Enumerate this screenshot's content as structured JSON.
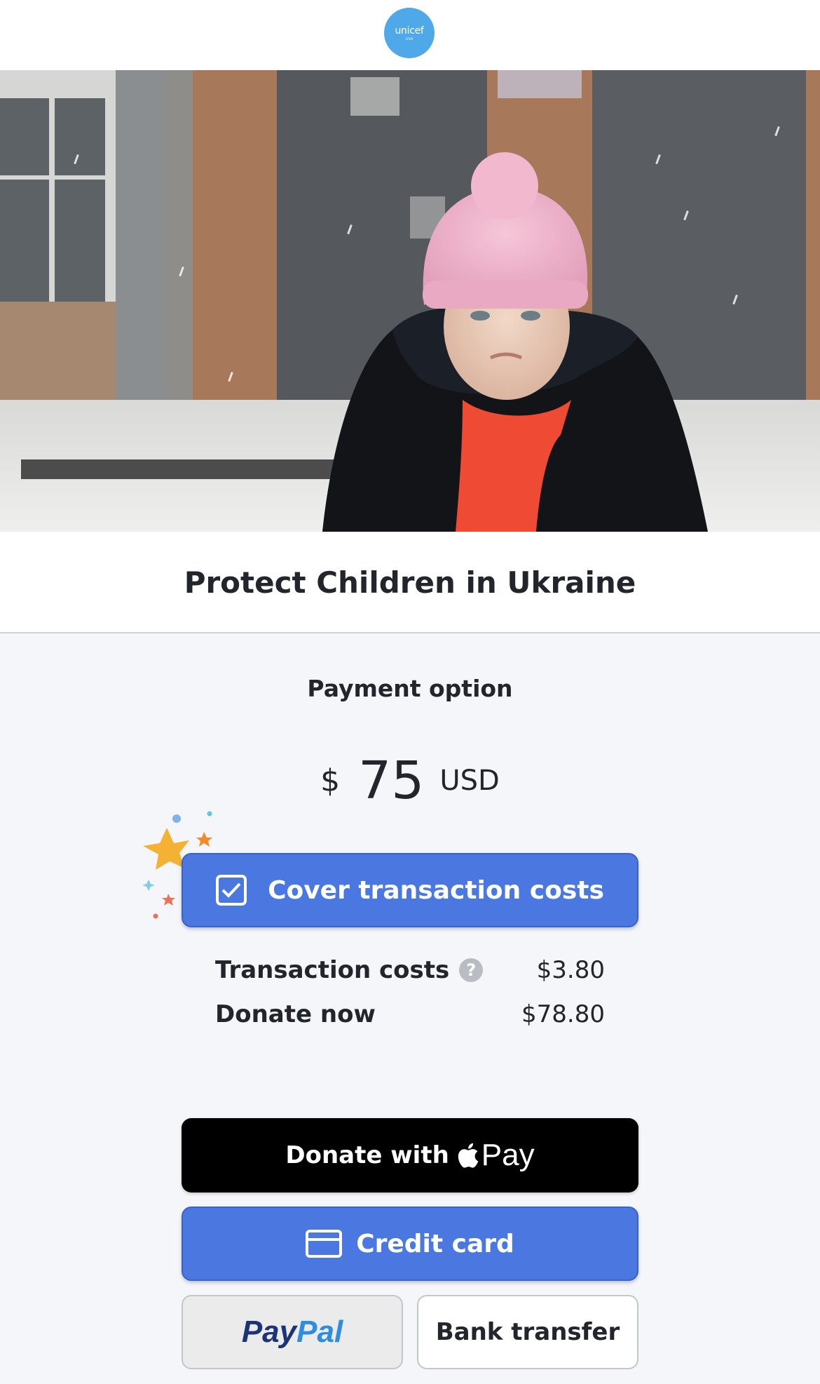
{
  "header": {
    "logo_text": "unicef",
    "logo_subtext": "USA",
    "logo_icon": "unicef-emblem-icon"
  },
  "hero": {
    "image": "child-in-pink-hat-snow-photo"
  },
  "campaign": {
    "title": "Protect Children in Ukraine"
  },
  "payment": {
    "section_title": "Payment option",
    "currency_symbol": "$",
    "amount": "75",
    "currency_code": "USD",
    "cover_costs_label": "Cover transaction costs",
    "cover_costs_checked": true,
    "transaction_costs_label": "Transaction costs",
    "transaction_costs_value": "$3.80",
    "donate_now_label": "Donate now",
    "donate_now_value": "$78.80"
  },
  "methods": {
    "apple_pay_prefix": "Donate with",
    "apple_pay_word": "Pay",
    "credit_card_label": "Credit card",
    "paypal_part1": "Pay",
    "paypal_part2": "Pal",
    "bank_transfer_label": "Bank transfer"
  },
  "colors": {
    "primary_blue": "#4a78e0",
    "logo_blue": "#4fa9e8",
    "apple_black": "#000000",
    "paypal_dark": "#1b3477",
    "paypal_light": "#2d8ee0"
  }
}
